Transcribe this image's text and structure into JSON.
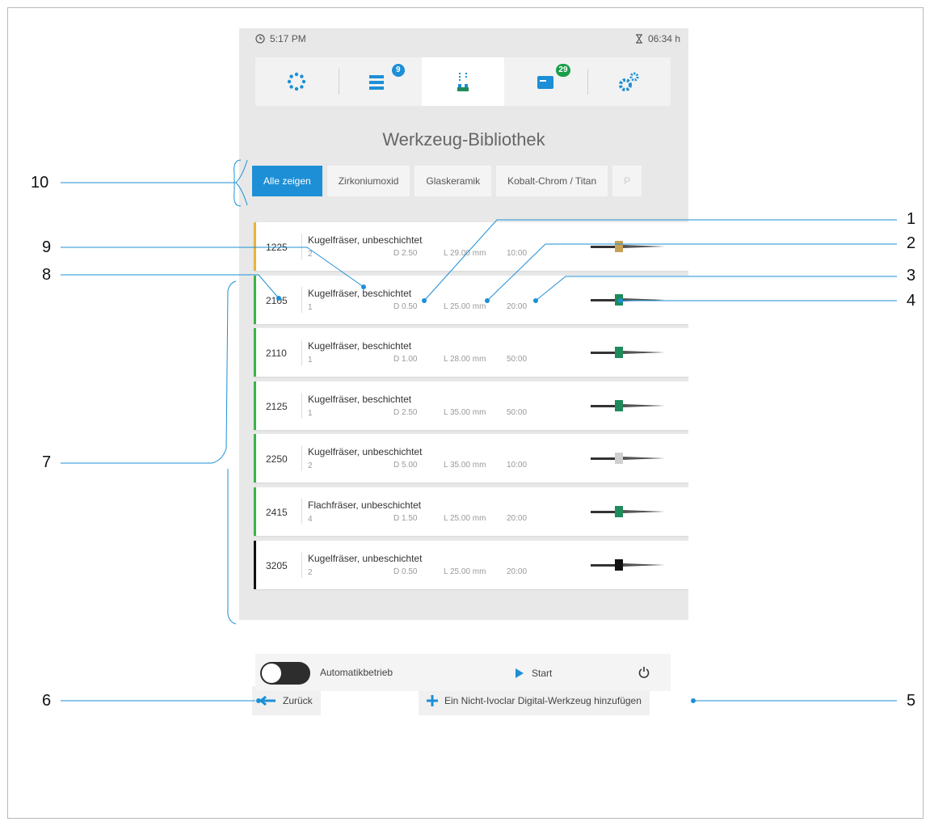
{
  "status": {
    "time": "5:17 PM",
    "timer": "06:34 h"
  },
  "nav": {
    "tabs": [
      {
        "icon": "dots-ring-icon"
      },
      {
        "icon": "job-list-icon",
        "badge": "9"
      },
      {
        "icon": "tool-library-icon"
      },
      {
        "icon": "materials-icon",
        "badge": "29"
      },
      {
        "icon": "settings-gears-icon"
      }
    ]
  },
  "title": "Werkzeug-Bibliothek",
  "filters": [
    "Alle zeigen",
    "Zirkoniumoxid",
    "Glaskeramik",
    "Kobalt-Chrom / Titan",
    "P"
  ],
  "tools": [
    {
      "num": "1225",
      "name": "Kugelfräser, unbeschichtet",
      "count": "2",
      "diameter": "D 2.50",
      "length": "L 29.00 mm",
      "time": "10:00",
      "color": "#e8b43a",
      "tool_color": "#c9a055"
    },
    {
      "num": "2105",
      "name": "Kugelfräser, beschichtet",
      "count": "1",
      "diameter": "D 0.50",
      "length": "L 25.00 mm",
      "time": "20:00",
      "color": "#3bb34a",
      "tool_color": "#1f8a5b"
    },
    {
      "num": "2110",
      "name": "Kugelfräser, beschichtet",
      "count": "1",
      "diameter": "D 1.00",
      "length": "L 28.00 mm",
      "time": "50:00",
      "color": "#3bb34a",
      "tool_color": "#1f8a5b"
    },
    {
      "num": "2125",
      "name": "Kugelfräser, beschichtet",
      "count": "1",
      "diameter": "D 2.50",
      "length": "L 35.00 mm",
      "time": "50:00",
      "color": "#3bb34a",
      "tool_color": "#1f8a5b"
    },
    {
      "num": "2250",
      "name": "Kugelfräser, unbeschichtet",
      "count": "2",
      "diameter": "D 5.00",
      "length": "L 35.00 mm",
      "time": "10:00",
      "color": "#3bb34a",
      "tool_color": "#cfcfcf"
    },
    {
      "num": "2415",
      "name": "Flachfräser, unbeschichtet",
      "count": "4",
      "diameter": "D 1.50",
      "length": "L 25.00 mm",
      "time": "20:00",
      "color": "#3bb34a",
      "tool_color": "#1f8a5b"
    },
    {
      "num": "3205",
      "name": "Kugelfräser, unbeschichtet",
      "count": "2",
      "diameter": "D 0.50",
      "length": "L 25.00 mm",
      "time": "20:00",
      "color": "#111111",
      "tool_color": "#111111"
    }
  ],
  "buttons": {
    "back": "Zurück",
    "add_tool": "Ein Nicht-Ivoclar Digital-Werkzeug hinzufügen",
    "auto_mode": "Automatikbetrieb",
    "start": "Start"
  },
  "callouts": [
    "1",
    "2",
    "3",
    "4",
    "5",
    "6",
    "7",
    "8",
    "9",
    "10"
  ]
}
